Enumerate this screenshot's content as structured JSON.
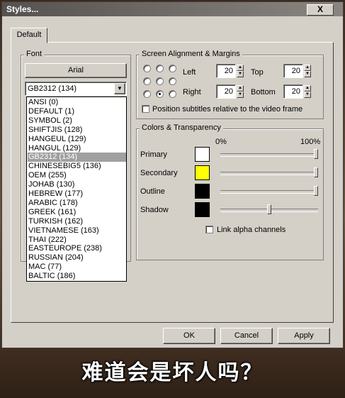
{
  "window": {
    "title": "Styles...",
    "close_label": "X"
  },
  "tab": {
    "label": "Default"
  },
  "font": {
    "group_label": "Font",
    "button_label": "Arial",
    "charset_selected": "GB2312 (134)",
    "charset_options": [
      "ANSI (0)",
      "DEFAULT (1)",
      "SYMBOL (2)",
      "SHIFTJIS (128)",
      "HANGEUL (129)",
      "HANGUL (129)",
      "GB2312 (134)",
      "CHINESEBIG5 (136)",
      "OEM (255)",
      "JOHAB (130)",
      "HEBREW (177)",
      "ARABIC (178)",
      "GREEK (161)",
      "TURKISH (162)",
      "VIETNAMESE (163)",
      "THAI (222)",
      "EASTEUROPE (238)",
      "RUSSIAN (204)",
      "MAC (77)",
      "BALTIC (186)"
    ]
  },
  "alignment": {
    "group_label": "Screen Alignment & Margins",
    "left_label": "Left",
    "left_value": "20",
    "top_label": "Top",
    "top_value": "20",
    "right_label": "Right",
    "right_value": "20",
    "bottom_label": "Bottom",
    "bottom_value": "20",
    "position_checkbox_label": "Position subtitles relative to the video frame"
  },
  "colors": {
    "group_label": "Colors & Transparency",
    "pct_min": "0%",
    "pct_max": "100%",
    "rows": [
      {
        "label": "Primary",
        "color": "#ffffff",
        "alpha": 1.0
      },
      {
        "label": "Secondary",
        "color": "#ffff00",
        "alpha": 1.0
      },
      {
        "label": "Outline",
        "color": "#000000",
        "alpha": 1.0
      },
      {
        "label": "Shadow",
        "color": "#000000",
        "alpha": 0.5
      }
    ],
    "link_alpha_label": "Link alpha channels"
  },
  "buttons": {
    "ok": "OK",
    "cancel": "Cancel",
    "apply": "Apply"
  },
  "video_subtitle": "难道会是坏人吗？"
}
